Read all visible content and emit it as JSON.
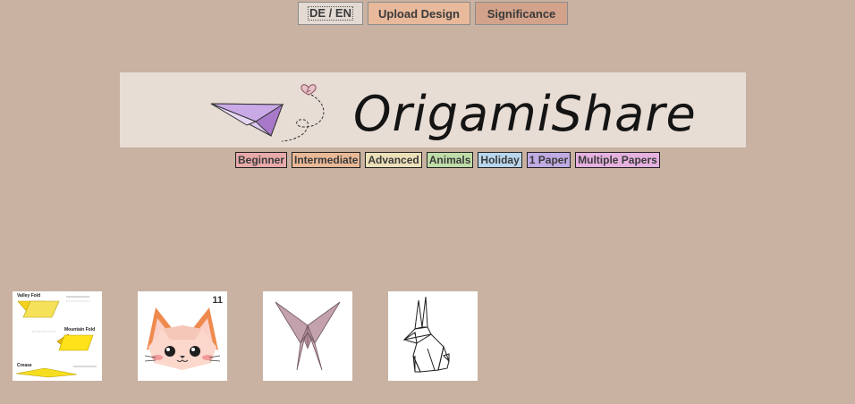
{
  "topbar": {
    "language_label": "DE / EN",
    "upload_label": "Upload Design",
    "significance_label": "Significance"
  },
  "header": {
    "logo_text": "OrigamiShare"
  },
  "tags": [
    {
      "label": "Beginner",
      "color": "#e8a9a9"
    },
    {
      "label": "Intermediate",
      "color": "#e9b997"
    },
    {
      "label": "Advanced",
      "color": "#ece0b9"
    },
    {
      "label": "Animals",
      "color": "#bfdda8"
    },
    {
      "label": "Holiday",
      "color": "#b9d6ec"
    },
    {
      "label": "1 Paper",
      "color": "#c0abe3"
    },
    {
      "label": "Multiple Papers",
      "color": "#e5b1df"
    }
  ],
  "gallery": {
    "cards": [
      {
        "name": "fold-guide",
        "labels": [
          "Valley Fold",
          "Mountain Fold",
          "Crease"
        ]
      },
      {
        "name": "cat-face",
        "badge": "11"
      },
      {
        "name": "butterfly"
      },
      {
        "name": "rabbit"
      }
    ]
  },
  "colors": {
    "background": "#c9b2a2",
    "banner": "#e8ddd5"
  }
}
